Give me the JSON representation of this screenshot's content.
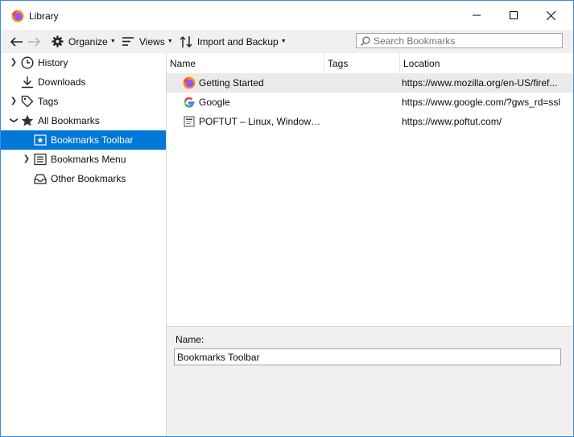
{
  "window": {
    "title": "Library"
  },
  "toolbar": {
    "organize_label": "Organize",
    "views_label": "Views",
    "import_label": "Import and Backup",
    "search_placeholder": "Search Bookmarks"
  },
  "sidebar": {
    "items": [
      {
        "label": "History",
        "icon": "clock-icon",
        "expandable": true
      },
      {
        "label": "Downloads",
        "icon": "download-arrow-icon",
        "expandable": false
      },
      {
        "label": "Tags",
        "icon": "tag-icon",
        "expandable": true
      },
      {
        "label": "All Bookmarks",
        "icon": "star-icon",
        "expanded": true
      },
      {
        "label": "Bookmarks Toolbar",
        "icon": "bookmarks-toolbar-icon",
        "selected": true
      },
      {
        "label": "Bookmarks Menu",
        "icon": "bookmarks-menu-icon",
        "expandable": true
      },
      {
        "label": "Other Bookmarks",
        "icon": "tray-icon",
        "expandable": false
      }
    ]
  },
  "columns": {
    "name": "Name",
    "tags": "Tags",
    "location": "Location"
  },
  "bookmarks": [
    {
      "name": "Getting Started",
      "tags": "",
      "location": "https://www.mozilla.org/en-US/firef...",
      "icon": "firefox-icon"
    },
    {
      "name": "Google",
      "tags": "",
      "location": "https://www.google.com/?gws_rd=ssl",
      "icon": "google-icon"
    },
    {
      "name": "POFTUT – Linux, Windows, ...",
      "tags": "",
      "location": "https://www.poftut.com/",
      "icon": "poftut-icon"
    }
  ],
  "details": {
    "name_label": "Name:",
    "name_value": "Bookmarks Toolbar"
  },
  "colors": {
    "selection": "#0078d7",
    "toolbar_bg": "#f0f0f0",
    "hover_row": "#eaeaea"
  }
}
